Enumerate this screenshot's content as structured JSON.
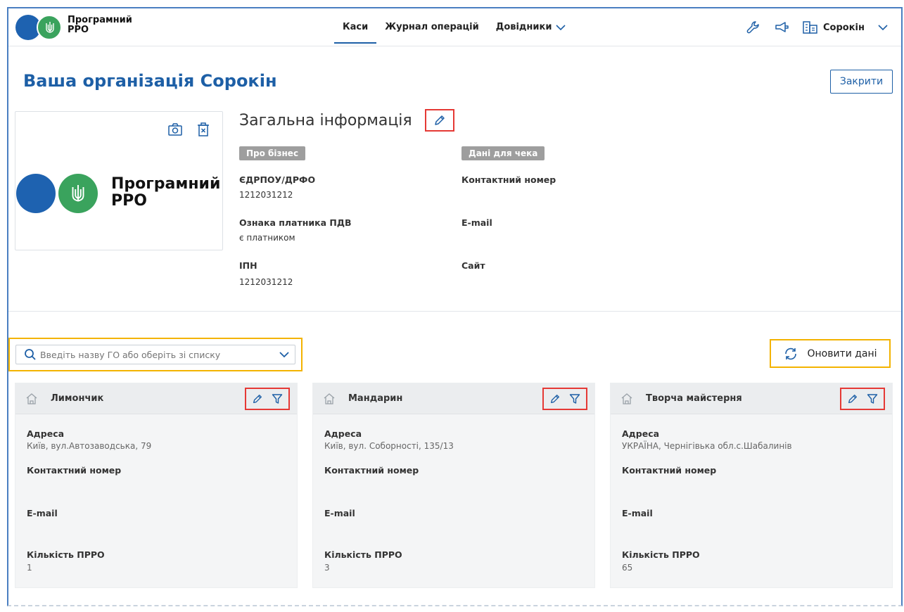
{
  "header": {
    "app_name": "Програмний РРО",
    "app_name_line1": "Програмний",
    "app_name_line2": "РРО",
    "nav": [
      {
        "label": "Каси",
        "active": true
      },
      {
        "label": "Журнал операцій",
        "active": false
      },
      {
        "label": "Довідники",
        "active": false,
        "has_dropdown": true
      }
    ],
    "icons": [
      "wrench-icon",
      "megaphone-icon",
      "organization-icon"
    ],
    "user_name": "Сорокін"
  },
  "page": {
    "title": "Ваша організація Сорокін",
    "close_label": "Закрити"
  },
  "logo_card": {
    "line1": "Програмний",
    "line2": "РРО",
    "tools": [
      "camera-icon",
      "delete-icon"
    ]
  },
  "general_info": {
    "title": "Загальна інформація",
    "business_tag": "Про бізнес",
    "receipt_tag": "Дані для чека",
    "fields_left": [
      {
        "label": "ЄДРПОУ/ДРФО",
        "value": "1212031212"
      },
      {
        "label": "Ознака платника ПДВ",
        "value": "є платником"
      },
      {
        "label": "ІПН",
        "value": "1212031212"
      }
    ],
    "fields_right": [
      {
        "label": "Контактний номер",
        "value": ""
      },
      {
        "label": "E-mail",
        "value": ""
      },
      {
        "label": "Сайт",
        "value": ""
      }
    ]
  },
  "search": {
    "placeholder": "Введіть назву ГО або оберіть зі списку"
  },
  "refresh_label": "Оновити дані",
  "shops": [
    {
      "name": "Лимончик",
      "address_label": "Адреса",
      "address": "Київ, вул.Автозаводська, 79",
      "phone_label": "Контактний номер",
      "phone": "",
      "email_label": "E-mail",
      "email": "",
      "count_label": "Кількість ПРРО",
      "count": "1"
    },
    {
      "name": "Мандарин",
      "address_label": "Адреса",
      "address": "Київ, вул. Соборності, 135/13",
      "phone_label": "Контактний номер",
      "phone": "",
      "email_label": "E-mail",
      "email": "",
      "count_label": "Кількість ПРРО",
      "count": "3"
    },
    {
      "name": "Творча майстерня",
      "address_label": "Адреса",
      "address": "УКРАЇНА, Чернігівька обл.с.Шабалинів",
      "phone_label": "Контактний номер",
      "phone": "",
      "email_label": "E-mail",
      "email": "",
      "count_label": "Кількість ПРРО",
      "count": "65"
    }
  ],
  "colors": {
    "primary": "#1d5fa6",
    "logo_blue": "#1e62b0",
    "logo_green": "#3aa35d",
    "highlight_red": "#e53935",
    "highlight_yellow": "#f3b300",
    "tag_gray": "#9e9e9e"
  }
}
